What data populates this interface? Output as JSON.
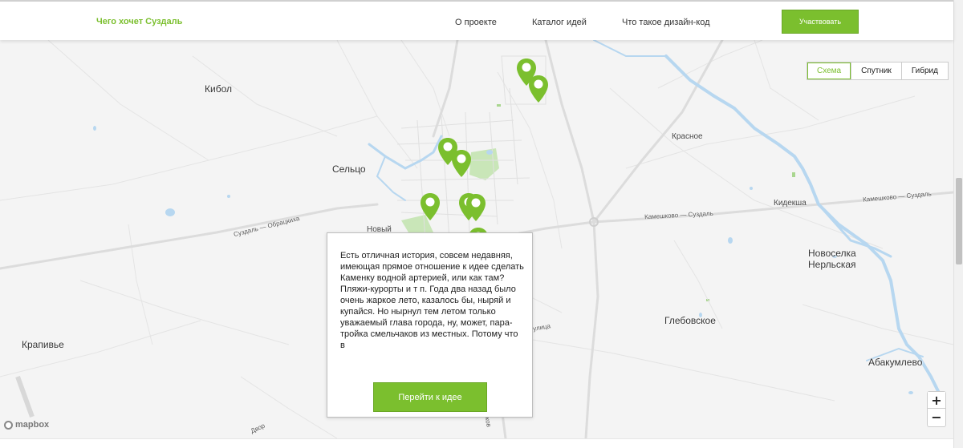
{
  "header": {
    "brand": "Чего хочет Суздаль",
    "nav": [
      "О проекте",
      "Каталог идей",
      "Что такое дизайн-код"
    ],
    "cta": "Участвовать"
  },
  "map": {
    "layers": [
      "Схема",
      "Спутник",
      "Гибрид"
    ],
    "active_layer": "Схема",
    "places": [
      "Кибол",
      "Сельцо",
      "Новый",
      "Красное",
      "Кидекша",
      "Новоселка",
      "Нерльская",
      "Глебовское",
      "Крапивье",
      "Абакумлево"
    ],
    "roads": [
      "Суздаль — Обрацкиха",
      "Камешково — Суздаль",
      "Камешково — Суздаль"
    ],
    "road_fragments": [
      "улица",
      "Двор",
      "рьков"
    ],
    "zoom": {
      "in": "+",
      "out": "−"
    },
    "attribution": "mapbox"
  },
  "popup": {
    "text": "Есть отличная история, совсем недавняя, имеющая прямое отношение к идее сделать Каменку водной артерией, или как там? Пляжи-курорты и т п. Года два назад было очень жаркое лето, казалось бы, ныряй и купайся. Но нырнул тем летом только уважаемый глава города, ну, может, пара-тройка смельчаков из местных. Потому что в",
    "button": "Перейти к идее"
  },
  "colors": {
    "accent": "#7bbf2e",
    "water": "#b7d7f0",
    "park": "#c9e6b8",
    "road": "#e2e2e2"
  }
}
